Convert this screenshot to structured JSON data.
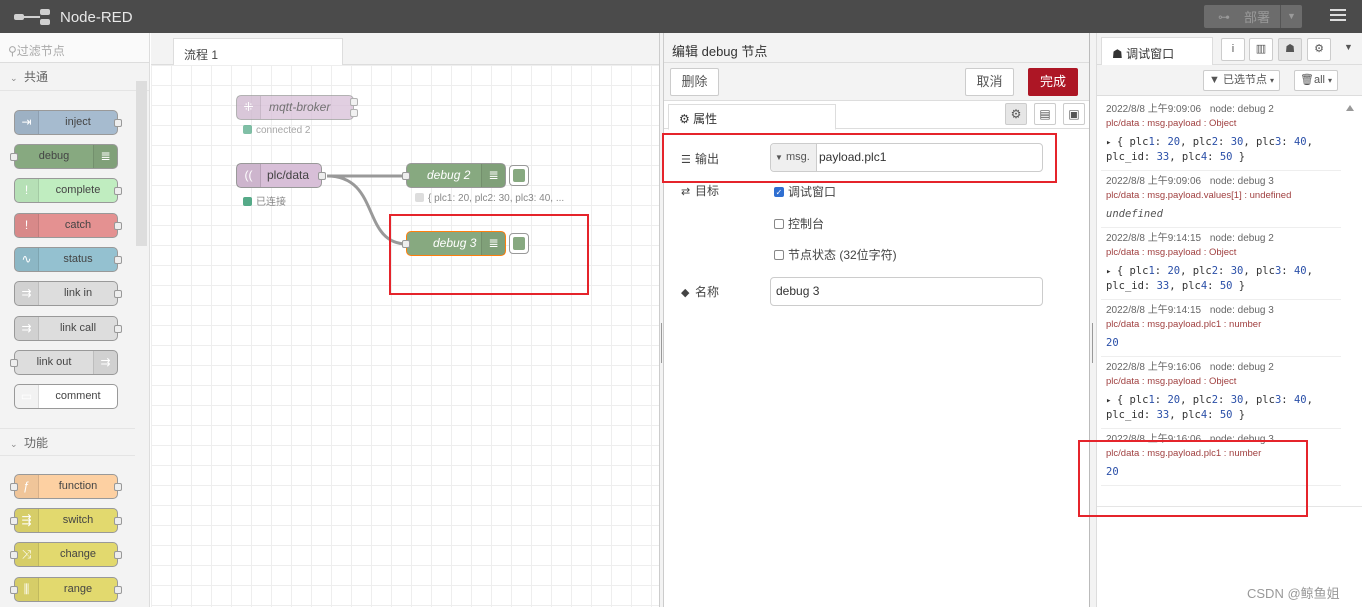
{
  "header": {
    "title": "Node-RED",
    "deploy_label": "部署",
    "colors": {
      "bar": "#4b4b4b",
      "deploy": "#6c6c6c"
    }
  },
  "palette": {
    "search_placeholder": "过滤节点",
    "categories": [
      {
        "label": "共通",
        "nodes": [
          {
            "label": "inject",
            "color": "#a6bbcf",
            "icon": "arrow-in-icon"
          },
          {
            "label": "debug",
            "color": "#87a980",
            "icon": "list-icon"
          },
          {
            "label": "complete",
            "color": "#c0edc0",
            "icon": "exclamation-icon"
          },
          {
            "label": "catch",
            "color": "#e49191",
            "icon": "exclamation-icon"
          },
          {
            "label": "status",
            "color": "#94c1d0",
            "icon": "pulse-icon"
          },
          {
            "label": "link in",
            "color": "#dddddd",
            "icon": "link-icon"
          },
          {
            "label": "link call",
            "color": "#dddddd",
            "icon": "link-icon"
          },
          {
            "label": "link out",
            "color": "#dddddd",
            "icon": "link-icon"
          },
          {
            "label": "comment",
            "color": "#ffffff",
            "icon": "comment-icon"
          }
        ]
      },
      {
        "label": "功能",
        "nodes": [
          {
            "label": "function",
            "color": "#fdd0a2",
            "icon": "function-icon"
          },
          {
            "label": "switch",
            "color": "#e2d96e",
            "icon": "switch-icon"
          },
          {
            "label": "change",
            "color": "#e2d96e",
            "icon": "shuffle-icon"
          },
          {
            "label": "range",
            "color": "#e2d96e",
            "icon": "range-icon"
          }
        ]
      }
    ]
  },
  "workspace": {
    "tab_label": "流程 1",
    "nodes": {
      "mqtt_broker": {
        "label": "mqtt-broker",
        "status": "connected 2",
        "color": "#d8bfd8"
      },
      "plc_data": {
        "label": "plc/data",
        "status": "已连接",
        "color": "#d8bfd8"
      },
      "debug2": {
        "label": "debug 2",
        "status": "{ plc1: 20, plc2: 30, plc3: 40, ...",
        "color": "#87a980"
      },
      "debug3": {
        "label": "debug 3",
        "color": "#87a980"
      }
    }
  },
  "editor": {
    "title": "编辑 debug 节点",
    "delete_label": "删除",
    "cancel_label": "取消",
    "done_label": "完成",
    "tab_label": "属性",
    "output_label": "输出",
    "output_prefix": "msg.",
    "output_value": "payload.plc1",
    "target_label": "目标",
    "target_options": [
      {
        "label": "调试窗口",
        "checked": true
      },
      {
        "label": "控制台",
        "checked": false
      },
      {
        "label": "节点状态 (32位字符)",
        "checked": false
      }
    ],
    "name_label": "名称",
    "name_value": "debug 3",
    "done_color": "#ad1625"
  },
  "sidebar": {
    "tab_label": "调试窗口",
    "filter_label": "已选节点",
    "clear_label": "all",
    "messages": [
      {
        "time": "2022/8/8 上午9:09:06",
        "node": "node: debug 2",
        "topic": "plc/data : msg.payload : Object",
        "line1": "{ plc1: 20, plc2: 30, plc3: 40,",
        "line2": "plc_id: 33, plc4: 50 }"
      },
      {
        "time": "2022/8/8 上午9:09:06",
        "node": "node: debug 3",
        "topic": "plc/data : msg.payload.values[1] : undefined",
        "line1": "undefined"
      },
      {
        "time": "2022/8/8 上午9:14:15",
        "node": "node: debug 2",
        "topic": "plc/data : msg.payload : Object",
        "line1": "{ plc1: 20, plc2: 30, plc3: 40,",
        "line2": "plc_id: 33, plc4: 50 }"
      },
      {
        "time": "2022/8/8 上午9:14:15",
        "node": "node: debug 3",
        "topic": "plc/data : msg.payload.plc1 : number",
        "line1": "20"
      },
      {
        "time": "2022/8/8 上午9:16:06",
        "node": "node: debug 2",
        "topic": "plc/data : msg.payload : Object",
        "line1": "{ plc1: 20, plc2: 30, plc3: 40,",
        "line2": "plc_id: 33, plc4: 50 }"
      },
      {
        "time": "2022/8/8 上午9:16:06",
        "node": "node: debug 3",
        "topic": "plc/data : msg.payload.plc1 : number",
        "line1": "20"
      }
    ]
  },
  "watermark": "CSDN @鲸鱼姐",
  "highlight_color": "#e5242b"
}
